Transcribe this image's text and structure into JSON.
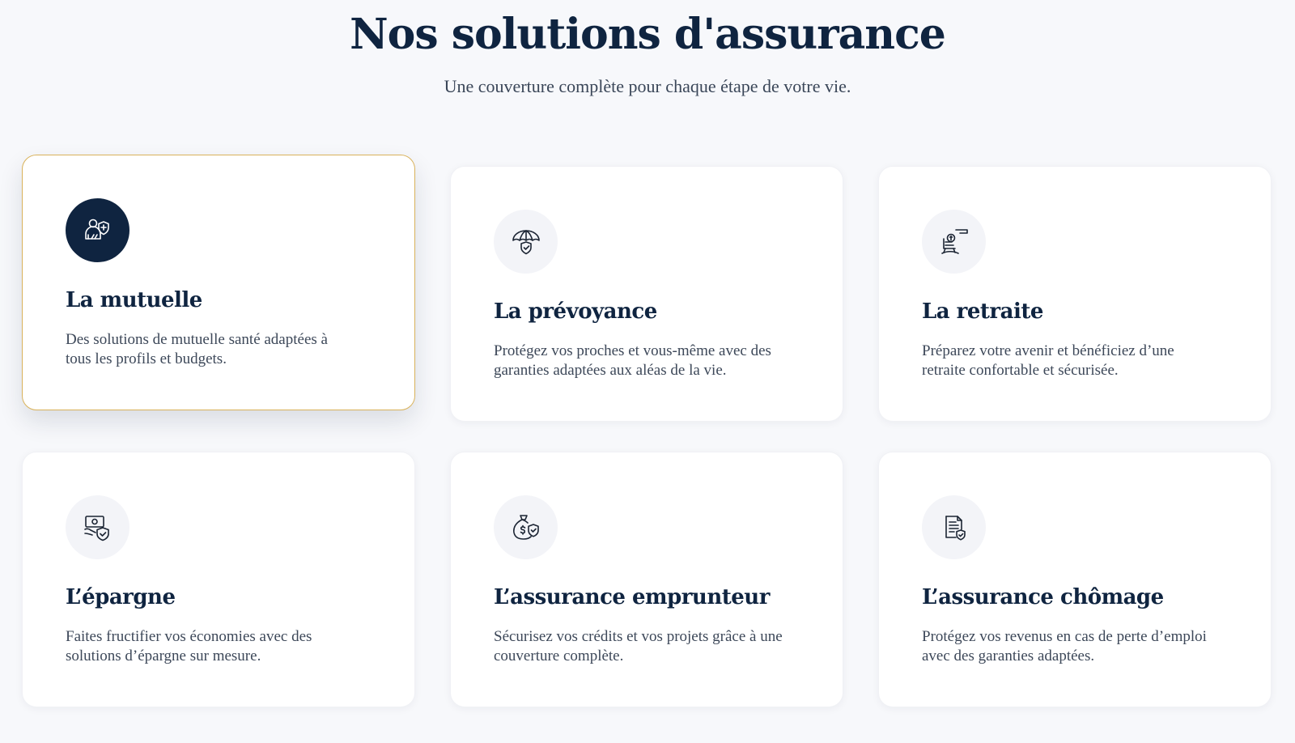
{
  "header": {
    "title": "Nos solutions d'assurance",
    "subtitle": "Une couverture complète pour chaque étape de votre vie."
  },
  "colors": {
    "navy": "#0f2440",
    "gold_border": "#d9b25a",
    "background": "#f7f8fb",
    "icon_bg": "#f3f4f8"
  },
  "cards": [
    {
      "title": "La mutuelle",
      "description": "Des solutions de mutuelle santé adaptées à tous les profils et budgets.",
      "icon": "health-person-icon",
      "active": true
    },
    {
      "title": "La prévoyance",
      "description": "Protégez vos proches et vous-même avec des garanties adaptées aux aléas de la vie.",
      "icon": "umbrella-shield-icon",
      "active": false
    },
    {
      "title": "La retraite",
      "description": "Préparez votre avenir et bénéficiez d’une retraite confortable et sécurisée.",
      "icon": "rocking-chair-coin-icon",
      "active": false
    },
    {
      "title": "L’épargne",
      "description": "Faites fructifier vos économies avec des solutions d’épargne sur mesure.",
      "icon": "money-shield-icon",
      "active": false
    },
    {
      "title": "L’assurance emprunteur",
      "description": "Sécurisez vos crédits et vos projets grâce à une couverture complète.",
      "icon": "money-bag-shield-icon",
      "active": false
    },
    {
      "title": "L’assurance chômage",
      "description": "Protégez vos revenus en cas de perte d’emploi avec des garanties adaptées.",
      "icon": "document-shield-icon",
      "active": false
    }
  ]
}
